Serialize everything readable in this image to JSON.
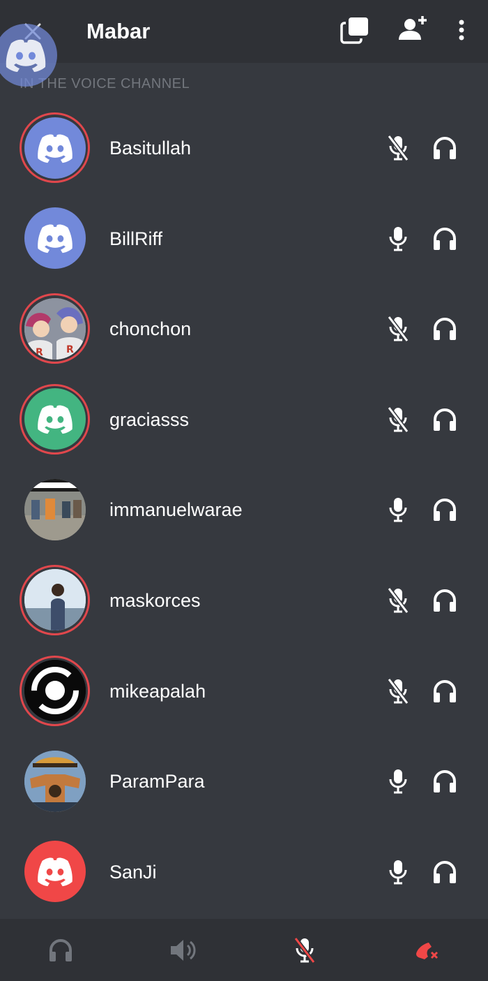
{
  "header": {
    "title": "Mabar",
    "icons": [
      "close-icon",
      "popout-icon",
      "add-user-icon",
      "more-vertical-icon"
    ]
  },
  "section": {
    "label": "IN THE VOICE CHANNEL"
  },
  "participants": [
    {
      "name": "Basitullah",
      "speaking": true,
      "avatar": "discord-default-blurple",
      "mic": "muted",
      "headphones": "on"
    },
    {
      "name": "BillRiff",
      "speaking": false,
      "avatar": "discord-default-blurple",
      "mic": "on",
      "headphones": "on"
    },
    {
      "name": "chonchon",
      "speaking": true,
      "avatar": "photo-anime-characters",
      "mic": "muted",
      "headphones": "on"
    },
    {
      "name": "graciasss",
      "speaking": true,
      "avatar": "discord-default-green",
      "mic": "muted",
      "headphones": "on"
    },
    {
      "name": "immanuelwarae",
      "speaking": false,
      "avatar": "photo-street-crowd",
      "mic": "on",
      "headphones": "on"
    },
    {
      "name": "maskorces",
      "speaking": true,
      "avatar": "photo-beach-person",
      "mic": "muted",
      "headphones": "on"
    },
    {
      "name": "mikeapalah",
      "speaking": true,
      "avatar": "logo-black-white-swirl",
      "mic": "muted",
      "headphones": "on"
    },
    {
      "name": "ParamPara",
      "speaking": false,
      "avatar": "photo-anime-pirate",
      "mic": "on",
      "headphones": "on"
    },
    {
      "name": "SanJi",
      "speaking": false,
      "avatar": "discord-default-red",
      "mic": "on",
      "headphones": "on"
    }
  ],
  "bottom_bar": {
    "icons": [
      "headphones-icon",
      "speaker-icon",
      "mic-muted-icon",
      "disconnect-icon"
    ]
  },
  "colors": {
    "background": "#36393f",
    "header": "#2f3136",
    "speaking_ring": "#e0474c",
    "blurple": "#7289da",
    "green": "#43b581",
    "red": "#f04747",
    "muted_text": "#72767d"
  }
}
